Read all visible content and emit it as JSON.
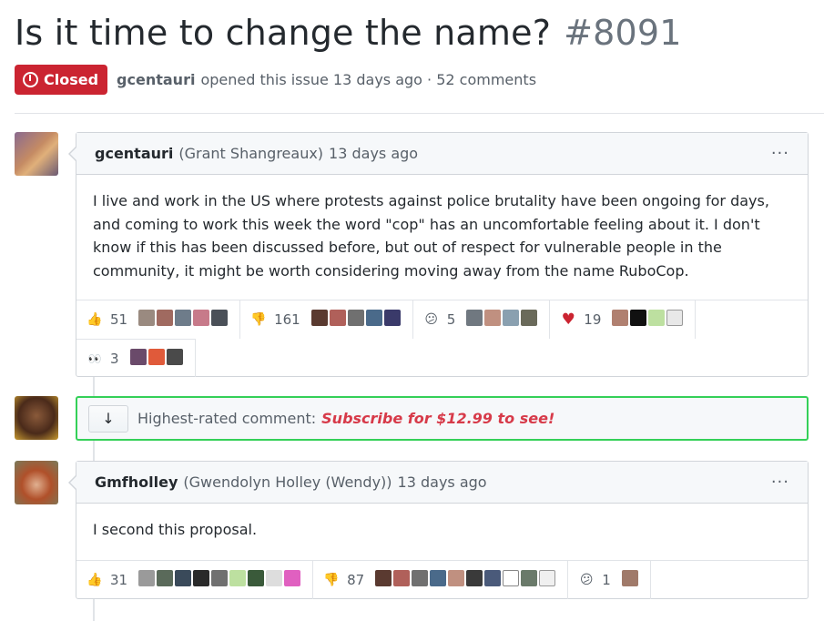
{
  "issue": {
    "title": "Is it time to change the name?",
    "number": "#8091",
    "state": "Closed",
    "author": "gcentauri",
    "opened_text": "opened this issue 13 days ago · 52 comments"
  },
  "comments": [
    {
      "username": "gcentauri",
      "fullname": "(Grant Shangreaux)",
      "time": "13 days ago",
      "menu": "···",
      "body": "I live and work in the US where protests against police brutality have been ongoing for days, and coming to work this week the word \"cop\" has an uncomfortable feeling about it. I don't know if this has been discussed before, but out of respect for vulnerable people in the community, it might be worth considering moving away from the name RuboCop.",
      "reactions": [
        {
          "icon": "thumbs-up",
          "glyph": "👍",
          "count": "51"
        },
        {
          "icon": "thumbs-down",
          "glyph": "👎",
          "count": "161"
        },
        {
          "icon": "confused",
          "glyph": "😕",
          "count": "5"
        },
        {
          "icon": "heart",
          "glyph": "♥",
          "count": "19"
        },
        {
          "icon": "eyes",
          "glyph": "👀",
          "count": "3"
        }
      ]
    },
    {
      "username": "Gmfholley",
      "fullname": "(Gwendolyn Holley (Wendy))",
      "time": "13 days ago",
      "menu": "···",
      "body": "I second this proposal.",
      "reactions": [
        {
          "icon": "thumbs-up",
          "glyph": "👍",
          "count": "31"
        },
        {
          "icon": "thumbs-down",
          "glyph": "👎",
          "count": "87"
        },
        {
          "icon": "confused",
          "glyph": "😕",
          "count": "1"
        }
      ]
    }
  ],
  "highlight": {
    "expand_glyph": "↓",
    "label": "Highest-rated comment:",
    "promo": "Subscribe for $12.99 to see!"
  },
  "colors": {
    "closed": "#cb2431",
    "highlight_border": "#34d058",
    "promo": "#d73a49"
  }
}
